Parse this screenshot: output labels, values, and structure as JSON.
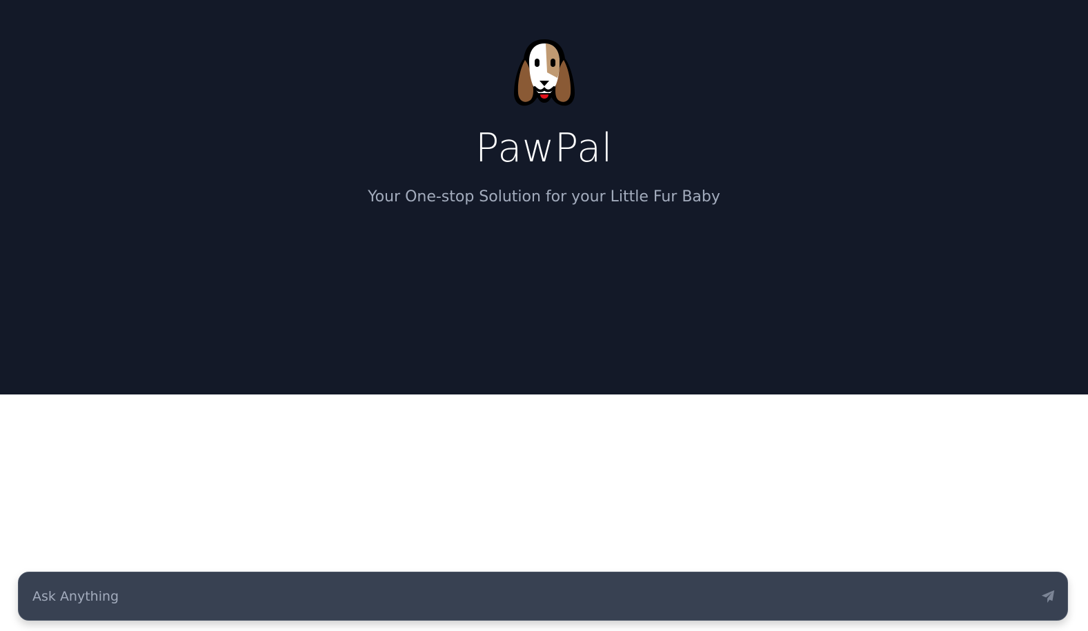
{
  "app": {
    "title": "PawPal",
    "tagline": "Your One-stop Solution for your Little Fur Baby"
  },
  "logo": {
    "icon": "beagle-dog-face-icon"
  },
  "chat_input": {
    "placeholder": "Ask Anything",
    "value": "",
    "send_icon": "paper-plane-send-icon"
  },
  "colors": {
    "hero_background": "#131928",
    "page_background": "#ffffff",
    "input_background": "#384152",
    "subtitle_text": "#a3acbd",
    "title_text": "#ffffff"
  }
}
